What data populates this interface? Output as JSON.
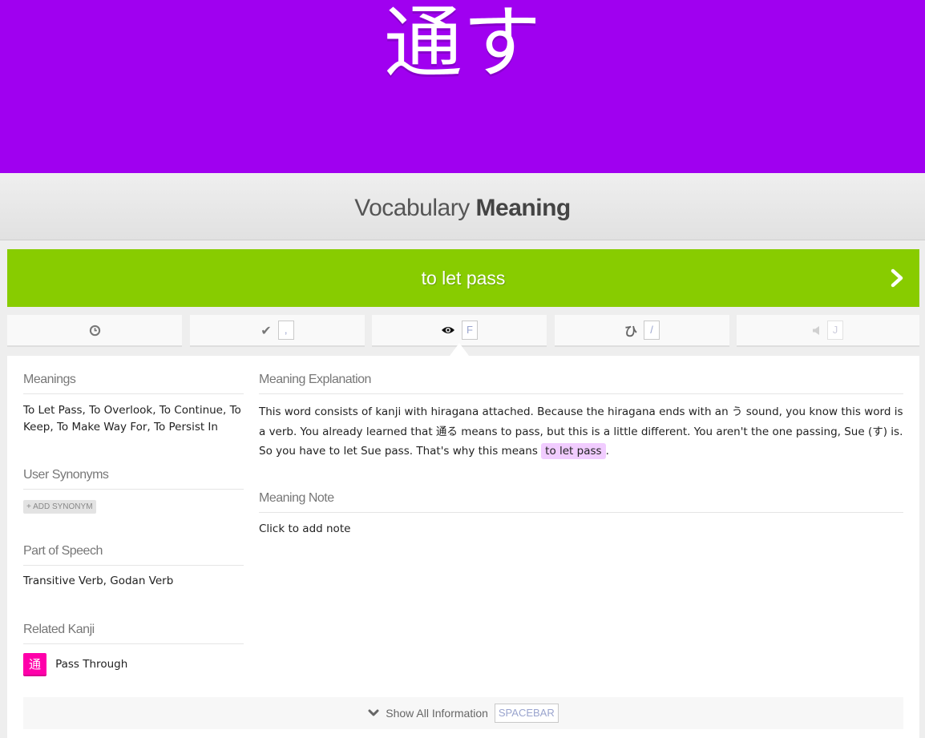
{
  "item": {
    "characters": "通す"
  },
  "question": {
    "type_word": "Vocabulary",
    "kind_word": "Meaning"
  },
  "answer": {
    "value": "to let pass",
    "next_icon": "chevron-right-icon"
  },
  "action_buttons": [
    {
      "icon": "clock-icon",
      "glyph": "◷",
      "key": ""
    },
    {
      "icon": "check-icon",
      "glyph": "✔",
      "key": ","
    },
    {
      "icon": "eye-icon",
      "glyph": "👁",
      "key": "F"
    },
    {
      "icon": "hiragana-icon",
      "glyph": "ひ",
      "key": "/"
    },
    {
      "icon": "audio-icon",
      "glyph": "◀",
      "key": "J"
    }
  ],
  "info": {
    "meanings": {
      "heading": "Meanings",
      "text": "To Let Pass, To Overlook, To Continue, To Keep, To Make Way For, To Persist In"
    },
    "user_synonyms": {
      "heading": "User Synonyms",
      "add_label": "+ ADD SYNONYM"
    },
    "part_of_speech": {
      "heading": "Part of Speech",
      "text": "Transitive Verb, Godan Verb"
    },
    "related_kanji": {
      "heading": "Related Kanji",
      "kanji": "通",
      "meaning": "Pass Through"
    },
    "meaning_explanation": {
      "heading": "Meaning Explanation",
      "text_before": "This word consists of kanji with hiragana attached. Because the hiragana ends with an う sound, you know this word is a verb. You already learned that 通る means to pass, but this is a little different. You aren't the one passing, Sue (す) is. So you have to let Sue pass. That's why this means ",
      "highlight": "to let pass",
      "text_after": "."
    },
    "meaning_note": {
      "heading": "Meaning Note",
      "placeholder": "Click to add note"
    }
  },
  "show_all": {
    "label": "Show All Information",
    "key": "SPACEBAR",
    "icon": "chevron-down-icon"
  },
  "colors": {
    "hero_bg": "#a000f0",
    "answer_correct": "#88cc00",
    "kanji_chip": "#ff00aa",
    "highlight": "#f1ccff"
  }
}
